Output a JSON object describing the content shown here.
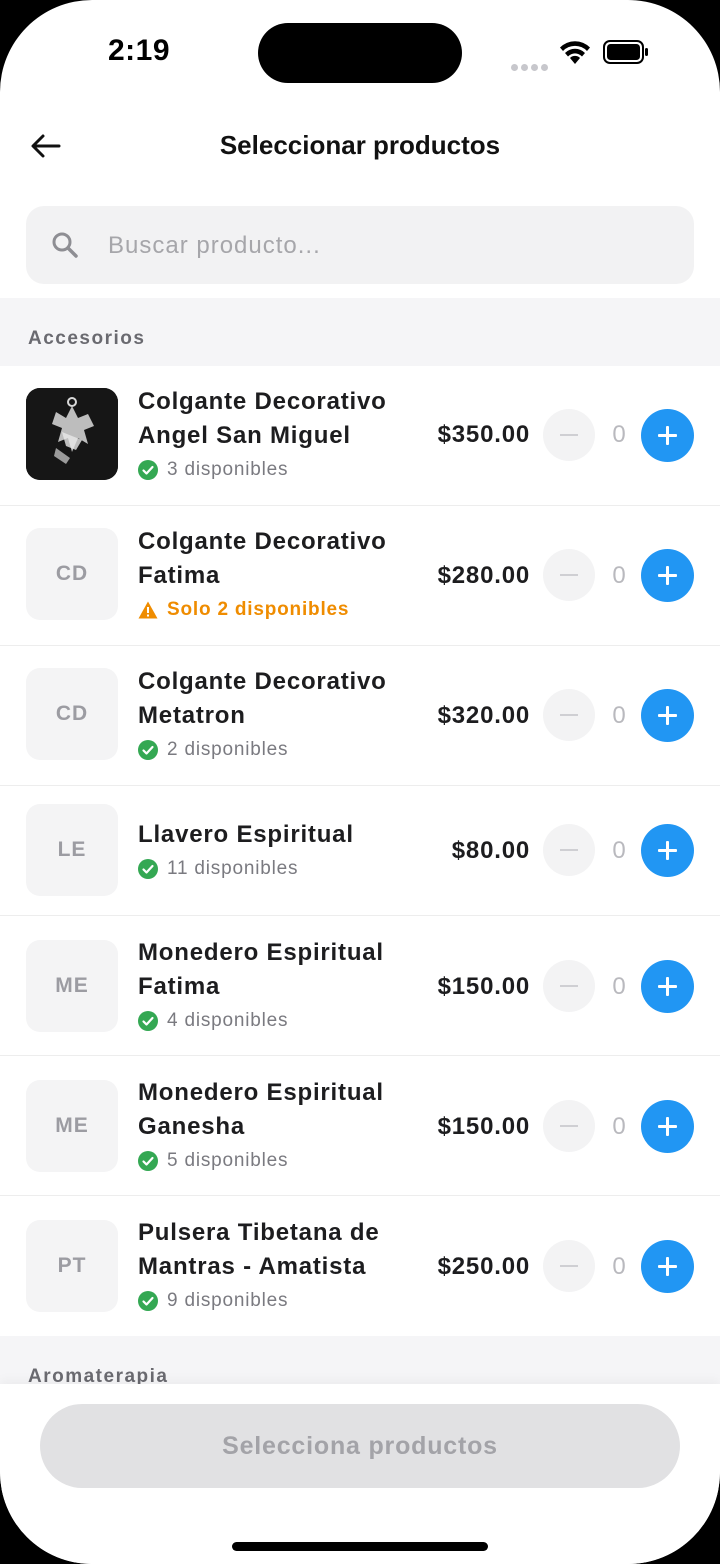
{
  "status_bar": {
    "time": "2:19"
  },
  "header": {
    "title": "Seleccionar productos"
  },
  "search": {
    "placeholder": "Buscar producto..."
  },
  "sections": [
    {
      "title": "Accesorios"
    },
    {
      "title": "Aromaterapia"
    }
  ],
  "products": [
    {
      "initials": "",
      "name": "Colgante Decorativo Angel San Miguel",
      "stock": "3 disponibles",
      "stock_level": "ok",
      "price": "$350.00",
      "qty": "0"
    },
    {
      "initials": "CD",
      "name": "Colgante Decorativo Fatima",
      "stock": "Solo 2 disponibles",
      "stock_level": "low",
      "price": "$280.00",
      "qty": "0"
    },
    {
      "initials": "CD",
      "name": "Colgante Decorativo Metatron",
      "stock": "2 disponibles",
      "stock_level": "ok",
      "price": "$320.00",
      "qty": "0"
    },
    {
      "initials": "LE",
      "name": "Llavero Espiritual",
      "stock": "11 disponibles",
      "stock_level": "ok",
      "price": "$80.00",
      "qty": "0"
    },
    {
      "initials": "ME",
      "name": "Monedero Espiritual Fatima",
      "stock": "4 disponibles",
      "stock_level": "ok",
      "price": "$150.00",
      "qty": "0"
    },
    {
      "initials": "ME",
      "name": "Monedero Espiritual Ganesha",
      "stock": "5 disponibles",
      "stock_level": "ok",
      "price": "$150.00",
      "qty": "0"
    },
    {
      "initials": "PT",
      "name": "Pulsera Tibetana de Mantras - Amatista",
      "stock": "9 disponibles",
      "stock_level": "ok",
      "price": "$250.00",
      "qty": "0"
    }
  ],
  "footer": {
    "button_label": "Selecciona productos"
  },
  "colors": {
    "accent": "#2196f3",
    "ok": "#34a853",
    "warning": "#ef8c00"
  }
}
